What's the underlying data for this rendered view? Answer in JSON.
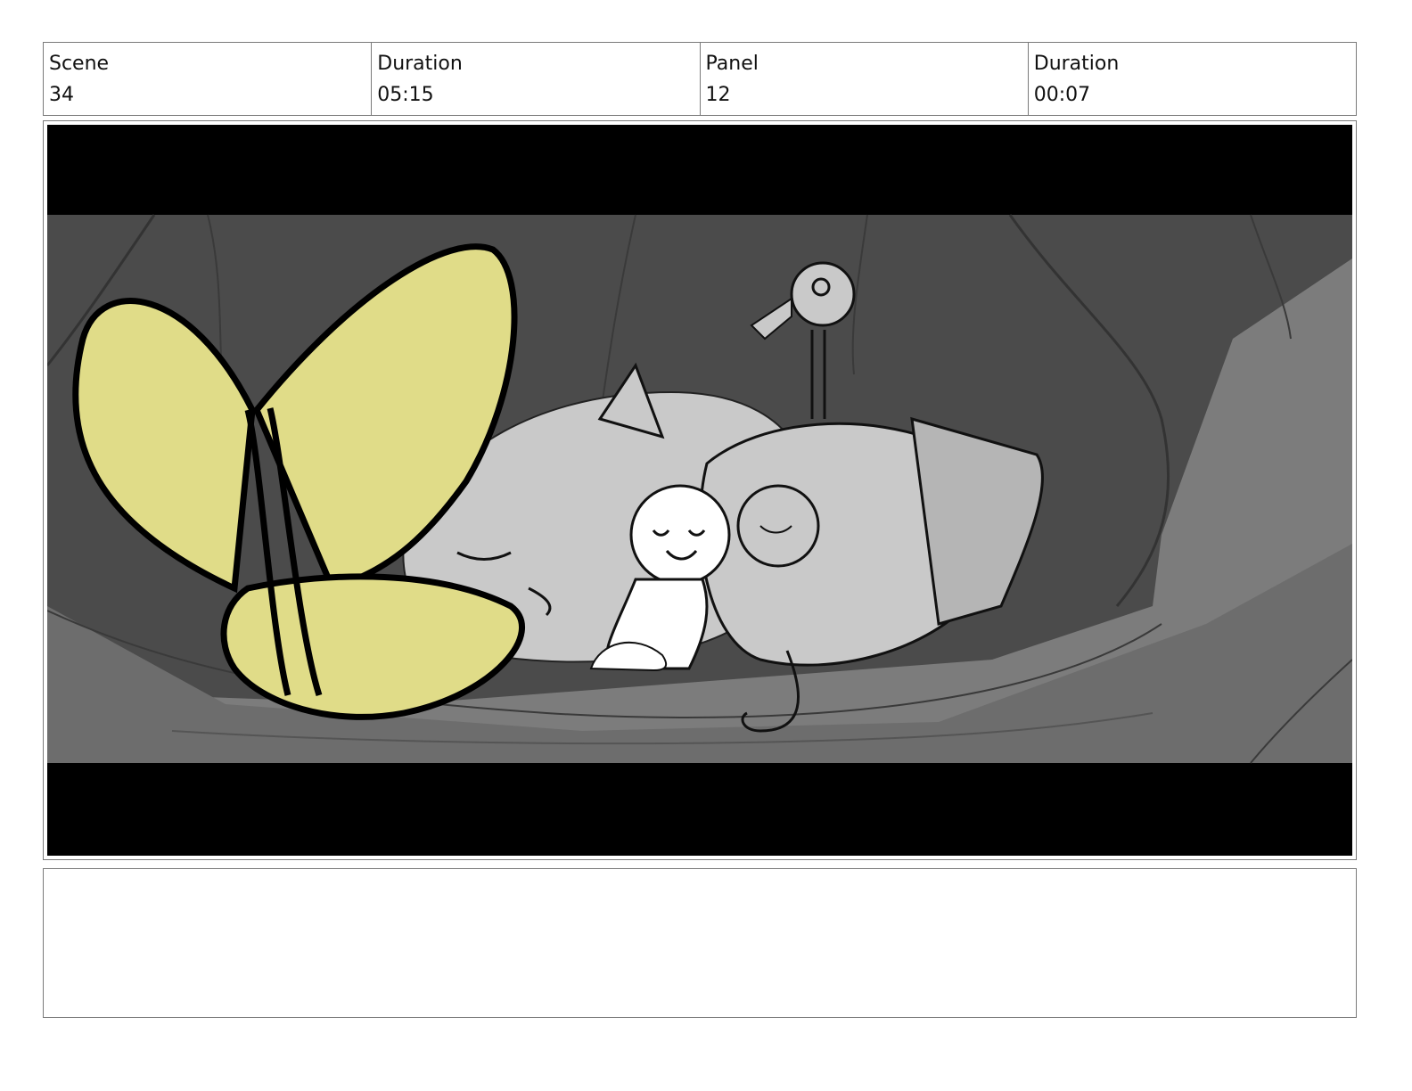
{
  "header": {
    "columns": [
      {
        "label": "Scene",
        "value": "34"
      },
      {
        "label": "Duration",
        "value": "05:15"
      },
      {
        "label": "Panel",
        "value": "12"
      },
      {
        "label": "Duration",
        "value": "00:07"
      }
    ]
  },
  "panel": {
    "colors": {
      "letterbox": "#000000",
      "wall_dark": "#4b4b4b",
      "wall_mid": "#7c7c7c",
      "character_gray": "#c9c9c9",
      "bow_yellow": "#e0dc88",
      "child_white": "#ffffff"
    }
  },
  "notes": {
    "text": ""
  }
}
